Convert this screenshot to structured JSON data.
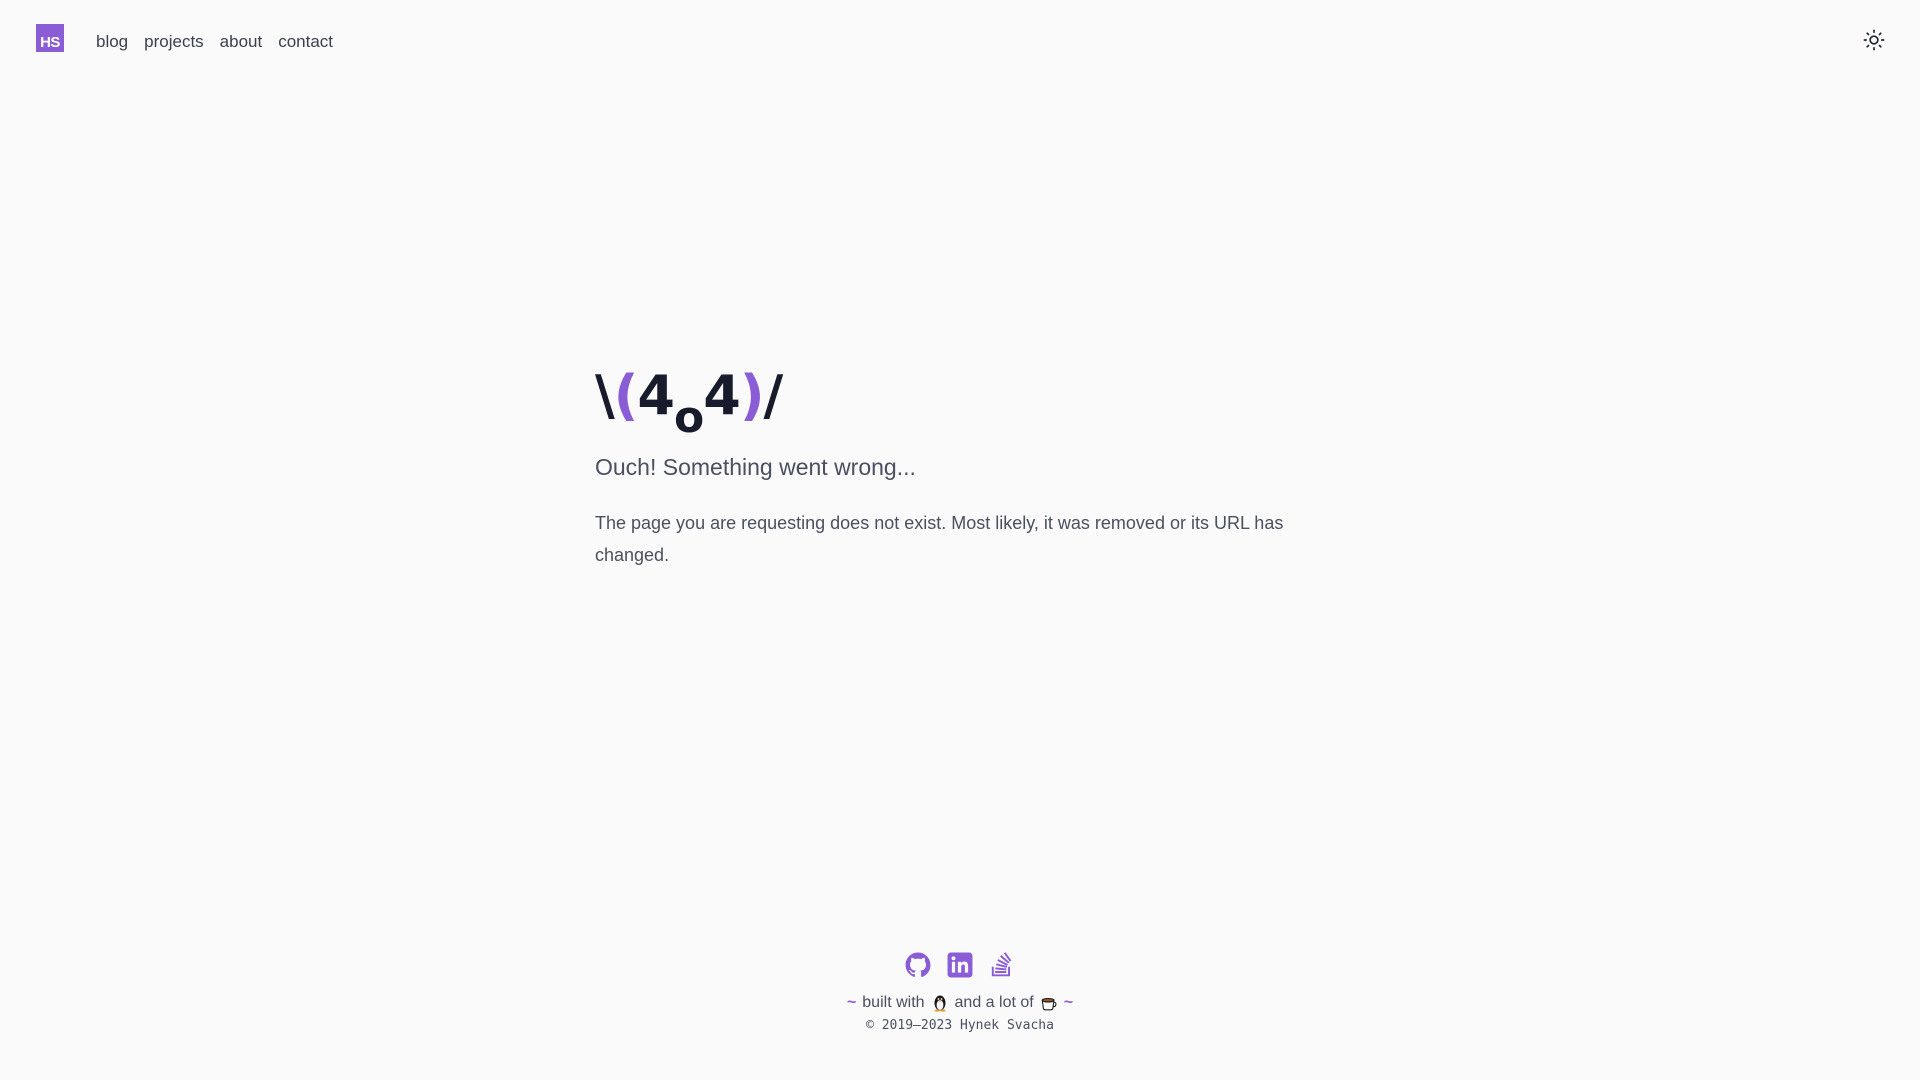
{
  "header": {
    "logo_text": "HS",
    "nav": {
      "blog": "blog",
      "projects": "projects",
      "about": "about",
      "contact": "contact"
    },
    "theme_toggle_icon": "sun-icon"
  },
  "main": {
    "headline": {
      "left_arm": "\\",
      "open_paren": "(",
      "digit1": "4",
      "subscript": "o",
      "digit2": "4",
      "close_paren": ")",
      "right_arm": "/"
    },
    "subtitle": "Ouch! Something went wrong...",
    "description": "The page you are requesting does not exist. Most likely, it was removed or its URL has changed."
  },
  "footer": {
    "social_icons": [
      "github-icon",
      "linkedin-icon",
      "stackoverflow-icon"
    ],
    "tilde": "~",
    "built_with": "built with",
    "and_a_lot_of": "and a lot of",
    "copyright": "© 2019–2023 Hynek Svacha"
  },
  "colors": {
    "accent": "#8a5cd6",
    "background": "#fafafa",
    "text": "#4a5060",
    "heading": "#171b2b"
  }
}
